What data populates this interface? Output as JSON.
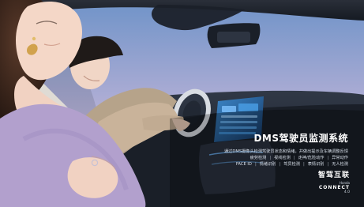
{
  "banner": {
    "title": "DMS驾驶员监测系统",
    "description": "通过DMS摄像头检测驾驶员状态和情绪，并做出提示及车辆调整反馈",
    "features_row1": [
      "疲劳检测",
      "视线检测",
      "走神/危险动作",
      "异常动作"
    ],
    "features_row2": [
      "FACE ID",
      "情绪识别",
      "驾员检测",
      "表情识别",
      "无人检测"
    ]
  },
  "brand": {
    "name": "智驾互联",
    "sub1": "Honda",
    "sub2": "CONNECT",
    "version": "4.0"
  },
  "colors": {
    "sky_top": "#6f93c8",
    "sky_bottom": "#e7b7c3",
    "cabin_dark": "#1e2430",
    "dashboard_dark": "#2a303b",
    "sweater": "#b2a0cd",
    "cream": "#f2efe8"
  }
}
